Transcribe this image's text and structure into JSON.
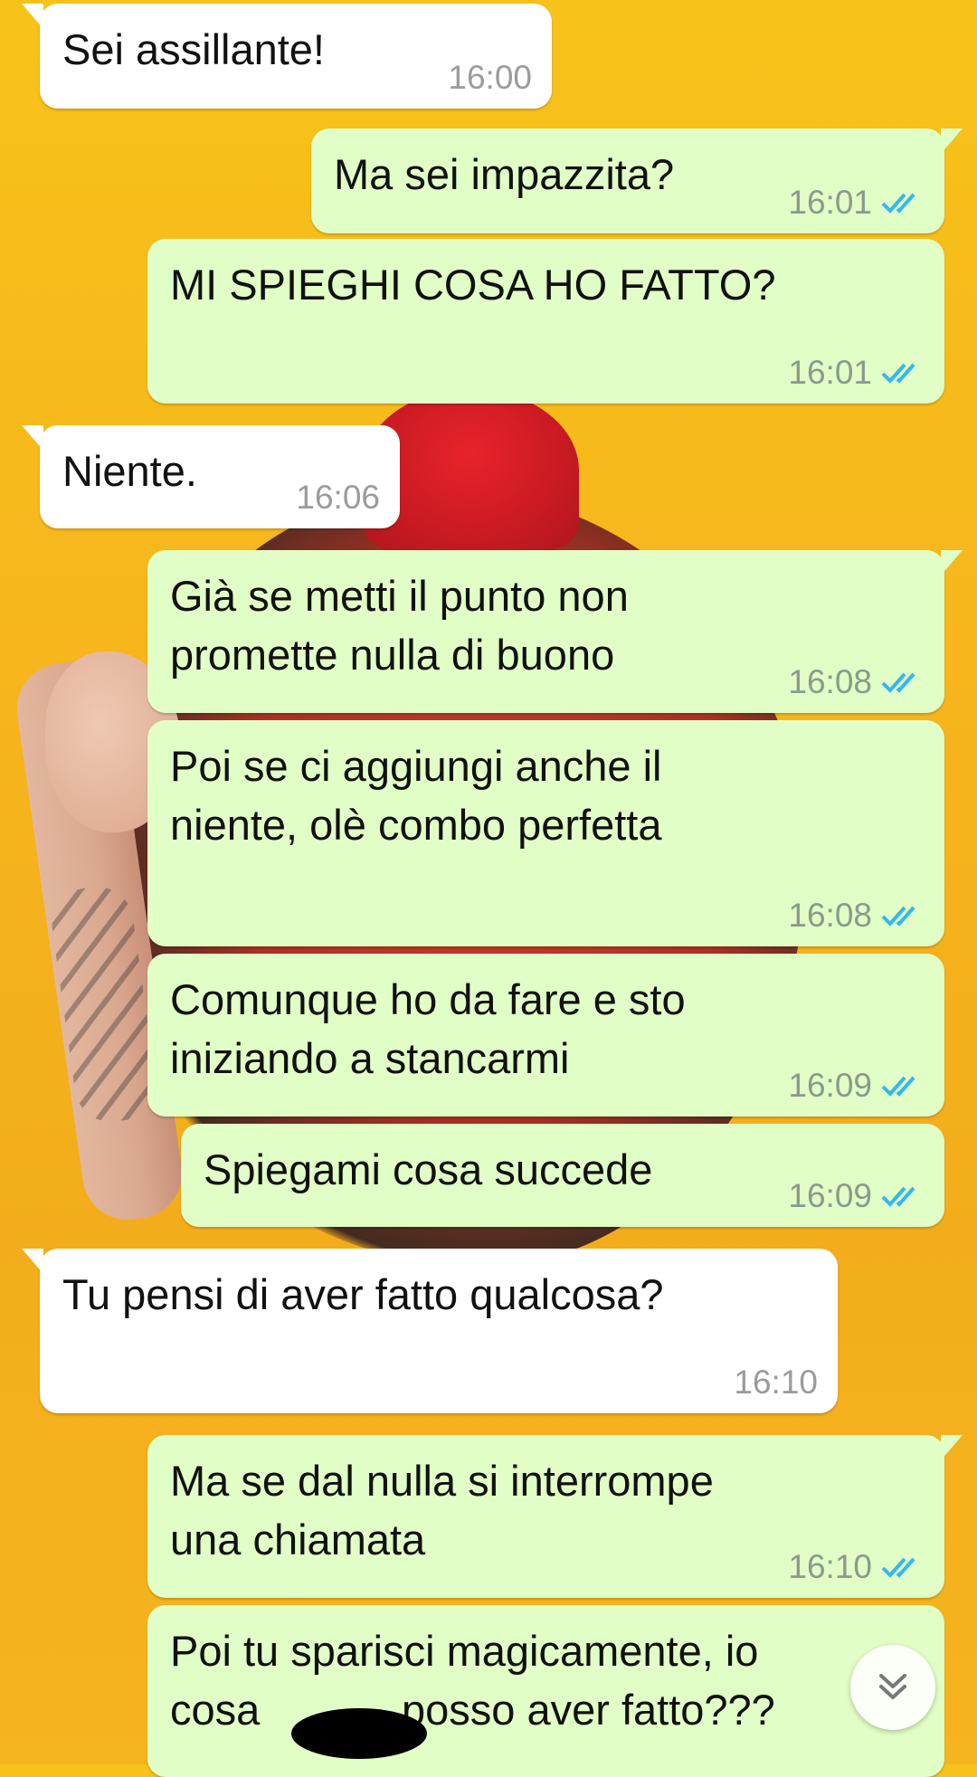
{
  "messages": [
    {
      "dir": "in",
      "text": "Sei assillante!",
      "time": "16:00",
      "tail": true
    },
    {
      "dir": "out",
      "text": "Ma sei impazzita?",
      "time": "16:01",
      "tail": true,
      "read": true
    },
    {
      "dir": "out",
      "text": "MI SPIEGHI COSA HO FATTO?",
      "time": "16:01",
      "read": true
    },
    {
      "dir": "in",
      "text": "Niente.",
      "time": "16:06",
      "tail": true
    },
    {
      "dir": "out",
      "text": "Già se metti il punto non\npromette nulla di buono",
      "time": "16:08",
      "tail": true,
      "read": true
    },
    {
      "dir": "out",
      "text": "Poi se ci aggiungi anche il\nniente, olè combo perfetta",
      "time": "16:08",
      "read": true
    },
    {
      "dir": "out",
      "text": "Comunque ho da fare e sto\niniziando a stancarmi",
      "time": "16:09",
      "read": true
    },
    {
      "dir": "out",
      "text": "Spiegami cosa succede",
      "time": "16:09",
      "read": true
    },
    {
      "dir": "in",
      "text": "Tu pensi di aver fatto qualcosa?",
      "time": "16:10",
      "tail": true
    },
    {
      "dir": "out",
      "text": "Ma se dal nulla si interrompe\nuna chiamata",
      "time": "16:10",
      "tail": true,
      "read": true
    },
    {
      "dir": "out",
      "text": "Poi tu sparisci magicamente, io\ncosa            posso aver fatto???",
      "time": "",
      "read": false
    }
  ],
  "colors": {
    "incoming": "#ffffff",
    "outgoing": "#e1fec6",
    "read_ticks": "#34b7f1",
    "wallpaper": "#f7c21a"
  },
  "icons": {
    "read_receipt": "double-check-icon",
    "scroll_down": "double-chevron-down-icon"
  }
}
